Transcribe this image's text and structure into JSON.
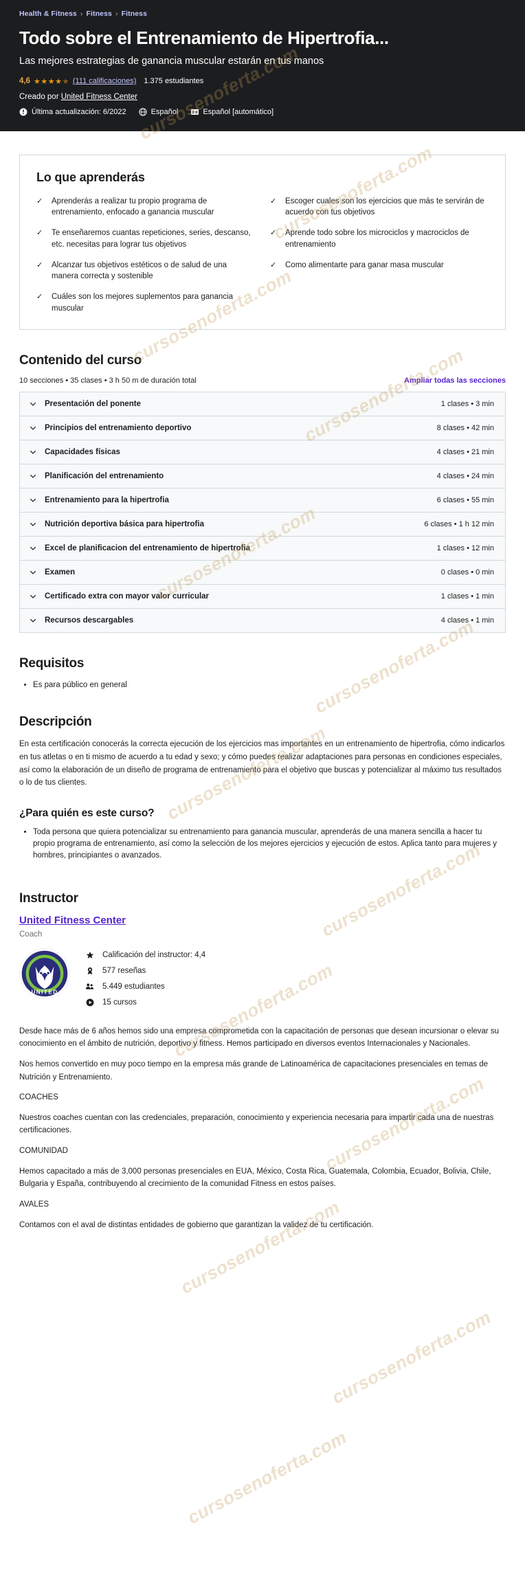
{
  "breadcrumb": {
    "items": [
      "Health & Fitness",
      "Fitness",
      "Fitness"
    ],
    "separator": "›"
  },
  "hero": {
    "title": "Todo sobre el Entrenamiento de Hipertrofia...",
    "subtitle": "Las mejores estrategias de ganancia muscular estarán en tus manos",
    "rating_value": "4,6",
    "stars": "★★★★",
    "half_star": "★",
    "ratings_link": "(111 calificaciones)",
    "students": "1.375 estudiantes",
    "created_by_prefix": "Creado por",
    "author": "United Fitness Center",
    "last_update": "Última actualización: 6/2022",
    "language": "Español",
    "captions": "Español [automático]",
    "icons": {
      "info": "exclamation-circle-icon",
      "globe": "globe-icon",
      "captions": "closed-captions-icon"
    },
    "bg_color": "#1c1d1f",
    "link_color": "#c0c4fc",
    "star_color": "#e59819"
  },
  "learn": {
    "title": "Lo que aprenderás",
    "check_glyph": "✓",
    "items": [
      "Aprenderás a realizar tu propio programa de entrenamiento, enfocado a ganancia muscular",
      "Escoger cuales son los ejercicios que más te servirán de acuerdo con tus objetivos",
      "Te enseñaremos cuantas repeticiones, series, descanso, etc. necesitas para lograr tus objetivos",
      "Aprende todo sobre los microciclos y macrociclos de entrenamiento",
      "Alcanzar tus objetivos estéticos o de salud de una manera correcta y sostenible",
      "Como alimentarte para ganar masa muscular",
      "Cuáles son los mejores suplementos para ganancia muscular"
    ]
  },
  "curriculum": {
    "title": "Contenido del curso",
    "stats": "10 secciones • 35 clases • 3 h 50 m de duración total",
    "expand_label": "Ampliar todas las secciones",
    "expand_color": "#5624d0",
    "sections": [
      {
        "title": "Presentación del ponente",
        "meta": "1 clases • 3 min"
      },
      {
        "title": "Principios del entrenamiento deportivo",
        "meta": "8 clases • 42 min"
      },
      {
        "title": "Capacidades físicas",
        "meta": "4 clases • 21 min"
      },
      {
        "title": "Planificación del entrenamiento",
        "meta": "4 clases • 24 min"
      },
      {
        "title": "Entrenamiento para la hipertrofia",
        "meta": "6 clases • 55 min"
      },
      {
        "title": "Nutrición deportiva básica para hipertrofia",
        "meta": "6 clases • 1 h 12 min"
      },
      {
        "title": "Excel de planificacion del entrenamiento de hipertrofia",
        "meta": "1 clases • 12 min"
      },
      {
        "title": "Examen",
        "meta": "0 clases • 0 min"
      },
      {
        "title": "Certificado extra con mayor valor curricular",
        "meta": "1 clases • 1 min"
      },
      {
        "title": "Recursos descargables",
        "meta": "4 clases • 1 min"
      }
    ]
  },
  "requirements": {
    "title": "Requisitos",
    "items": [
      "Es para público en general"
    ]
  },
  "description": {
    "title": "Descripción",
    "paragraphs": [
      "En esta certificación conocerás la correcta ejecución de los ejercicios mas importantes en un entrenamiento de hipertrofia, cómo indicarlos en tus atletas o en ti mismo de acuerdo a tu edad y sexo; y cómo puedes realizar adaptaciones para personas en condiciones especiales, así como la elaboración de un diseño de programa de entrenamiento para el objetivo que buscas y potencializar al máximo tus resultados o lo de tus clientes."
    ]
  },
  "audience": {
    "title": "¿Para quién es este curso?",
    "items": [
      "Toda persona que quiera potencializar su entrenamiento para ganancia muscular, aprenderás de una manera sencilla a hacer tu propio programa de entrenamiento, así como la selección de los mejores ejercicios y ejecución de estos. Aplica tanto para mujeres y hombres, principiantes o avanzados."
    ]
  },
  "instructor": {
    "title": "Instructor",
    "name": "United Fitness Center",
    "role": "Coach",
    "avatar_alt": "united-fitness-center-logo",
    "stats": [
      {
        "icon": "star-icon",
        "text": "Calificación del instructor: 4,4"
      },
      {
        "icon": "award-icon",
        "text": "577 reseñas"
      },
      {
        "icon": "users-icon",
        "text": "5.449 estudiantes"
      },
      {
        "icon": "play-circle-icon",
        "text": "15 cursos"
      }
    ],
    "bio": [
      "Desde hace más de 6 años hemos sido una empresa comprometida con la capacitación de personas que desean incursionar o elevar su conocimiento en el ámbito de nutrición, deportivo y fitness. Hemos participado en diversos eventos Internacionales y Nacionales.",
      "Nos hemos convertido en muy poco tiempo en la empresa más grande de Latinoamérica de capacitaciones presenciales en temas de Nutrición y Entrenamiento.",
      "COACHES",
      "Nuestros coaches cuentan con las credenciales, preparación, conocimiento y experiencia necesaria para impartir cada una de nuestras certificaciones.",
      "COMUNIDAD",
      "Hemos capacitado a más de 3,000 personas presenciales en EUA, México, Costa Rica, Guatemala, Colombia, Ecuador, Bolivia, Chile, Bulgaria y España, contribuyendo al crecimiento de la comunidad Fitness en estos países.",
      "AVALES",
      "Contamos con el aval de distintas entidades de gobierno que garantizan la validez de tu certificación."
    ]
  },
  "watermark": {
    "text": "cursosenoferta.com",
    "color": "#c49a58"
  }
}
